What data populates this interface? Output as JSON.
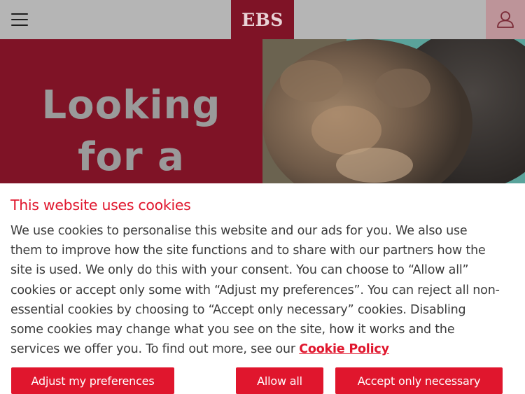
{
  "header": {
    "logo_text": "EBS",
    "menu_icon": "hamburger-menu-icon",
    "account_icon": "user-icon"
  },
  "hero": {
    "line1": "Looking",
    "line2": "for a"
  },
  "cookie_banner": {
    "title": "This website uses cookies",
    "body": "We use cookies to personalise this website and our ads for you. We also use them to improve how the site functions and to share with our partners how the site is used. We only do this with your consent. You can choose to “Allow all” cookies or accept only some with “Adjust my preferences”. You can reject all non-essential cookies by choosing to “Accept only necessary” cookies. Disabling some cookies may change what you see on the site, how it works and the services we offer you. To find out more, see our ",
    "link_text": "Cookie Policy",
    "buttons": {
      "adjust": "Adjust my preferences",
      "allow_all": "Allow all",
      "accept_necessary": "Accept only necessary"
    }
  },
  "colors": {
    "brand_red": "#e0162d",
    "hero_maroon": "#7f1326",
    "header_gray": "#b5b5b5"
  }
}
